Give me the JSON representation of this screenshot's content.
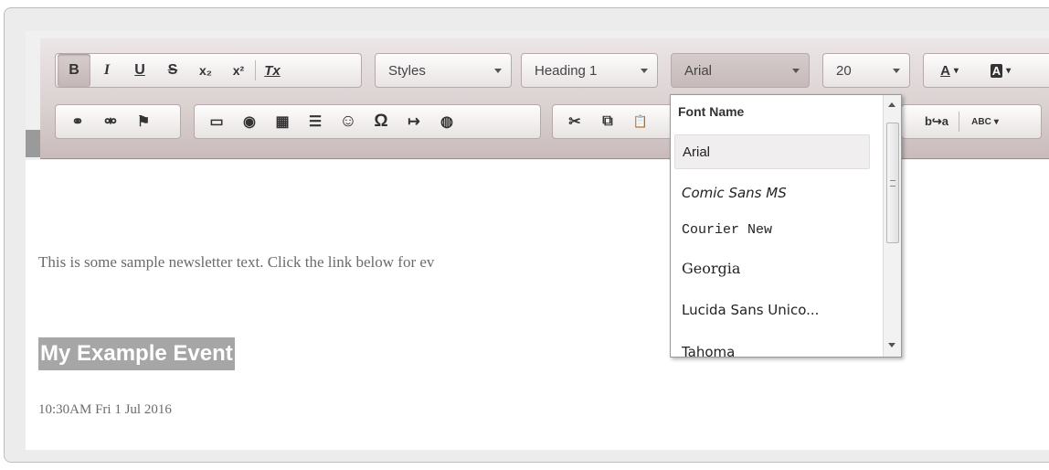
{
  "toolbar": {
    "row1": {
      "bold": "B",
      "italic": "I",
      "underline": "U",
      "strike": "S",
      "subscript": "x₂",
      "superscript": "x²",
      "remove_format": "Tx",
      "styles": "Styles",
      "format": "Heading 1",
      "font": "Arial",
      "size": "20",
      "text_color": "A",
      "bg_color": "A"
    },
    "row2": {
      "link": "⚭",
      "unlink": "⚮",
      "anchor": "⚑",
      "image": "▭",
      "flash": "◉",
      "table": "▦",
      "hline": "☰",
      "smiley": "☺",
      "special_char": "Ω",
      "pagebreak": "↦",
      "iframe": "◍",
      "cut": "✂",
      "copy": "⧉",
      "paste": "📋",
      "find_replace": "b↪a",
      "spellcheck": "ABC"
    }
  },
  "font_dropdown": {
    "title": "Font Name",
    "items": [
      {
        "label": "Arial",
        "selected": true
      },
      {
        "label": "Comic Sans MS",
        "selected": false
      },
      {
        "label": "Courier New",
        "selected": false
      },
      {
        "label": "Georgia",
        "selected": false
      },
      {
        "label": "Lucida Sans Unico...",
        "selected": false
      },
      {
        "label": "Tahoma",
        "selected": false
      }
    ]
  },
  "content": {
    "paragraph": "This is some sample newsletter text.  Click the link below for ev",
    "heading": "My Example Event",
    "date": "10:30AM Fri 1 Jul 2016"
  },
  "colors": {
    "toolbar_top": "#ece6e6",
    "toolbar_bottom": "#c9bbbb",
    "highlight": "#a6a6a6",
    "body_text": "#6b6b6b"
  }
}
